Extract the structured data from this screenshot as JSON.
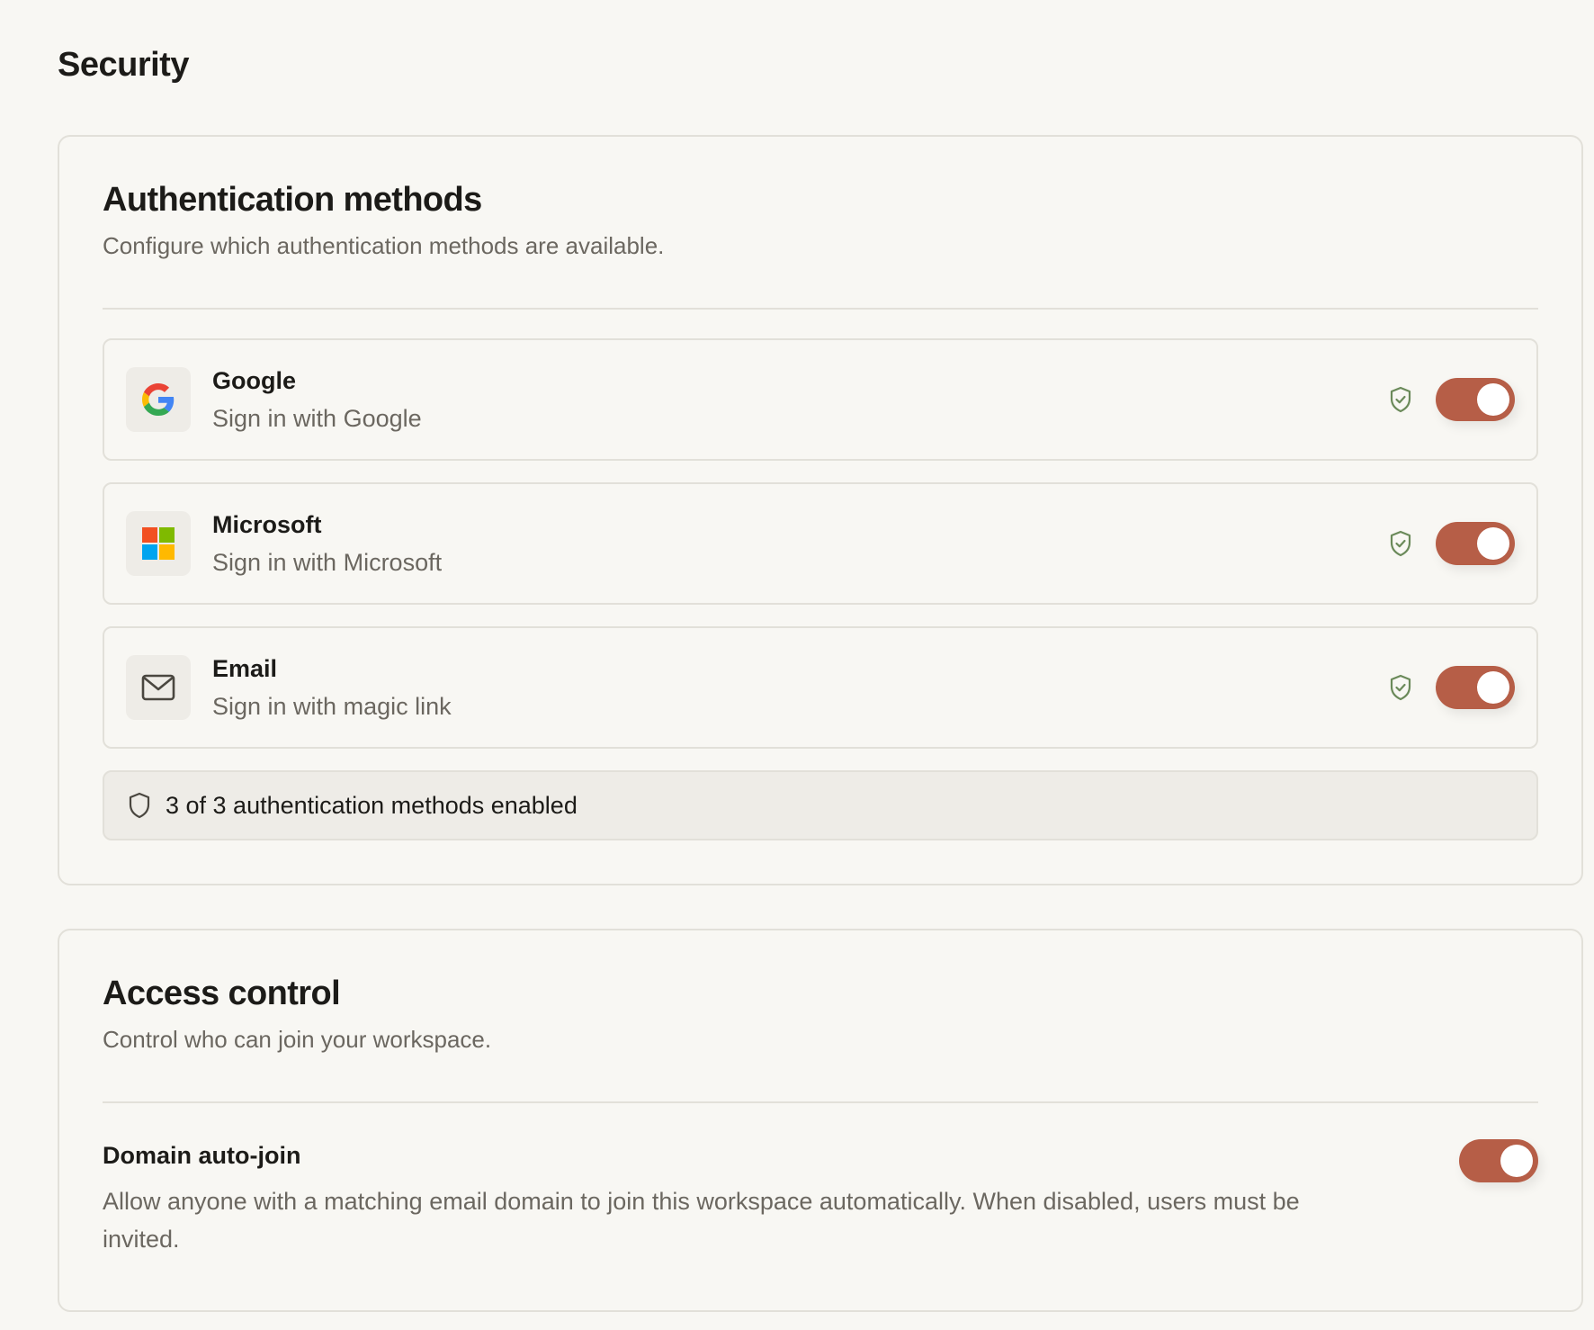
{
  "page": {
    "title": "Security"
  },
  "auth_methods": {
    "title": "Authentication methods",
    "description": "Configure which authentication methods are available.",
    "items": [
      {
        "name": "Google",
        "subtitle": "Sign in with Google",
        "icon": "google-logo-icon",
        "enabled": true
      },
      {
        "name": "Microsoft",
        "subtitle": "Sign in with Microsoft",
        "icon": "microsoft-logo-icon",
        "enabled": true
      },
      {
        "name": "Email",
        "subtitle": "Sign in with magic link",
        "icon": "envelope-icon",
        "enabled": true
      }
    ],
    "summary": "3 of 3 authentication methods enabled"
  },
  "access_control": {
    "title": "Access control",
    "description": "Control who can join your workspace.",
    "domain_auto_join": {
      "title": "Domain auto-join",
      "description": "Allow anyone with a matching email domain to join this workspace automatically. When disabled, users must be invited.",
      "enabled": true
    }
  },
  "colors": {
    "background": "#f8f7f3",
    "toggle_on": "#b65e47",
    "shield_check": "#6b8a5a",
    "border": "#e2e0d9",
    "muted_text": "#6b6760"
  }
}
